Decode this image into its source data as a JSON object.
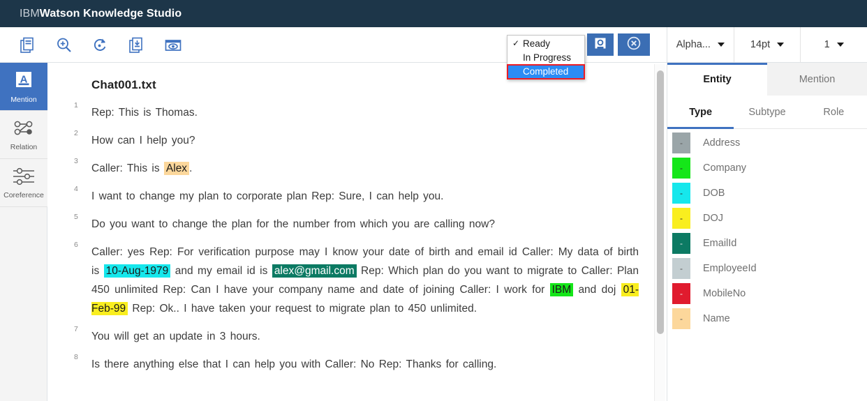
{
  "brand": {
    "prefix": "IBM",
    "name": "Watson Knowledge Studio"
  },
  "toolbar": {
    "icons": [
      {
        "name": "documents-icon",
        "label": "Documents"
      },
      {
        "name": "zoom-in-icon",
        "label": "Zoom"
      },
      {
        "name": "rotate-icon",
        "label": "Undo"
      },
      {
        "name": "document-download-icon",
        "label": "Export"
      },
      {
        "name": "preview-icon",
        "label": "Preview"
      }
    ],
    "actions": [
      {
        "name": "save-button",
        "icon": "save-disk-icon"
      },
      {
        "name": "close-button",
        "icon": "close-circle-icon"
      }
    ]
  },
  "status_dropdown": {
    "items": [
      {
        "label": "Ready",
        "checked": true,
        "selected": false
      },
      {
        "label": "In Progress",
        "checked": false,
        "selected": false
      },
      {
        "label": "Completed",
        "checked": false,
        "selected": true
      }
    ]
  },
  "rail": {
    "items": [
      {
        "label": "Mention",
        "icon": "mention-a-icon",
        "active": true
      },
      {
        "label": "Relation",
        "icon": "relation-nodes-icon",
        "active": false
      },
      {
        "label": "Coreference",
        "icon": "coreference-sliders-icon",
        "active": false
      }
    ]
  },
  "document": {
    "title": "Chat001.txt",
    "lines": [
      {
        "number": "1",
        "justify": false,
        "segments": [
          {
            "text": "Rep: This is Thomas."
          }
        ]
      },
      {
        "number": "2",
        "justify": false,
        "segments": [
          {
            "text": "How can I help you?"
          }
        ]
      },
      {
        "number": "3",
        "justify": false,
        "segments": [
          {
            "text": "Caller: This is "
          },
          {
            "text": "Alex",
            "highlight": "Name"
          },
          {
            "text": "."
          }
        ]
      },
      {
        "number": "4",
        "justify": true,
        "segments": [
          {
            "text": "I want to change my plan to corporate plan Rep: Sure, I can help you."
          }
        ]
      },
      {
        "number": "5",
        "justify": true,
        "segments": [
          {
            "text": "Do you want to change the plan for the number from which you are calling now?"
          }
        ]
      },
      {
        "number": "6",
        "justify": true,
        "segments": [
          {
            "text": "Caller: yes Rep: For verification purpose may I know your date of birth and email id Caller: My data of birth is "
          },
          {
            "text": "10-Aug-1979",
            "highlight": "DOB"
          },
          {
            "text": " and my email id is "
          },
          {
            "text": "alex@gmail.com",
            "highlight": "EmailId"
          },
          {
            "text": " Rep: Which plan do you want to migrate to Caller: Plan 450 unlimited Rep: Can I have your company name and date of joining Caller: I work for "
          },
          {
            "text": "IBM",
            "highlight": "Company"
          },
          {
            "text": " and doj "
          },
          {
            "text": "01-Feb-99",
            "highlight": "DOJ"
          },
          {
            "text": " Rep: Ok.. I have taken your request to migrate plan to 450 unlimited."
          }
        ]
      },
      {
        "number": "7",
        "justify": false,
        "segments": [
          {
            "text": "You will get an update in 3 hours."
          }
        ]
      },
      {
        "number": "8",
        "justify": true,
        "segments": [
          {
            "text": "Is there anything else that I can help you with Caller: No Rep: Thanks for calling."
          }
        ]
      }
    ]
  },
  "right_panel": {
    "selects": [
      {
        "name": "dictionary-select",
        "value": "Alpha..."
      },
      {
        "name": "fontsize-select",
        "value": "14pt"
      },
      {
        "name": "page-select",
        "value": "1"
      }
    ],
    "tabs": [
      {
        "label": "Entity",
        "active": true
      },
      {
        "label": "Mention",
        "active": false
      }
    ],
    "subtabs": [
      {
        "label": "Type",
        "active": true
      },
      {
        "label": "Subtype",
        "active": false
      },
      {
        "label": "Role",
        "active": false
      }
    ],
    "types": [
      {
        "label": "Address",
        "color": "#9aa5a8",
        "shortcut": "-",
        "text_color": "#555555"
      },
      {
        "label": "Company",
        "color": "#15e619",
        "shortcut": "-",
        "text_color": "#2a2a2a"
      },
      {
        "label": "DOB",
        "color": "#16e7ec",
        "shortcut": "-",
        "text_color": "#2a2a2a"
      },
      {
        "label": "DOJ",
        "color": "#f9ee1f",
        "shortcut": "-",
        "text_color": "#2a2a2a"
      },
      {
        "label": "EmailId",
        "color": "#0c7a63",
        "shortcut": "-",
        "text_color": "#e8e8e8"
      },
      {
        "label": "EmployeeId",
        "color": "#c3ced1",
        "shortcut": "-",
        "text_color": "#555555"
      },
      {
        "label": "MobileNo",
        "color": "#e01b2e",
        "shortcut": "-",
        "text_color": "#f0f0f0"
      },
      {
        "label": "Name",
        "color": "#fcd79b",
        "shortcut": "-",
        "text_color": "#555555"
      }
    ]
  },
  "highlight_colors": {
    "Name": {
      "bg": "#fcd79b",
      "fg": "#1a1a1a"
    },
    "DOB": {
      "bg": "#16e7ec",
      "fg": "#1a1a1a"
    },
    "EmailId": {
      "bg": "#0c7a63",
      "fg": "#ffffff"
    },
    "Company": {
      "bg": "#15e619",
      "fg": "#1a1a1a"
    },
    "DOJ": {
      "bg": "#f9ee1f",
      "fg": "#1a1a1a"
    }
  },
  "theme": {
    "brand_bar": "#1d3649",
    "accent_blue": "#3f72c0",
    "action_blue": "#3b6eb4",
    "selection_blue": "#2b8cf5",
    "annotation_red": "#ec1c24"
  }
}
